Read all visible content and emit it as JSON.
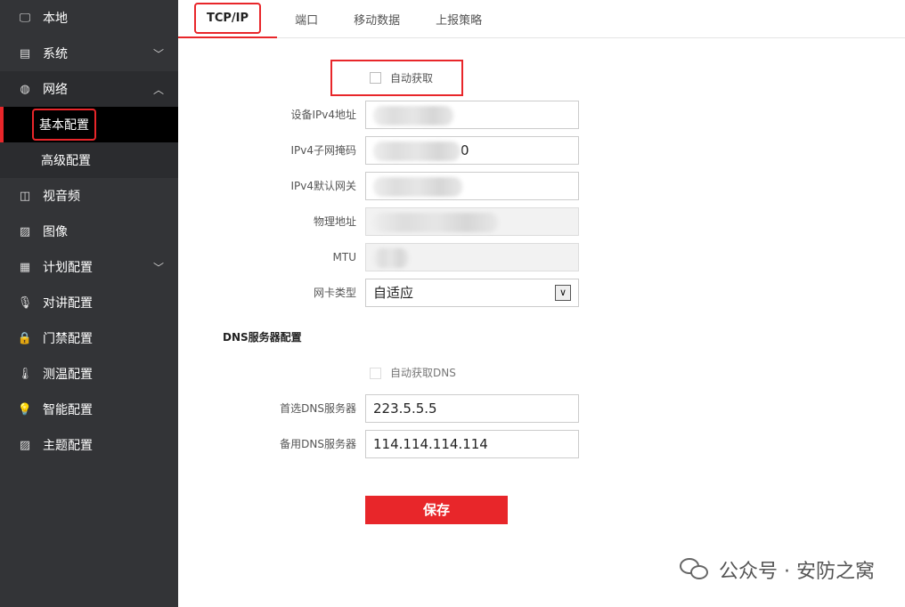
{
  "sidebar": {
    "items": [
      {
        "label": "本地",
        "icon": "monitor-icon"
      },
      {
        "label": "系统",
        "icon": "window-icon"
      },
      {
        "label": "网络",
        "icon": "globe-icon"
      },
      {
        "label": "基本配置"
      },
      {
        "label": "高级配置"
      },
      {
        "label": "视音频",
        "icon": "video-icon"
      },
      {
        "label": "图像",
        "icon": "image-icon"
      },
      {
        "label": "计划配置",
        "icon": "calendar-icon"
      },
      {
        "label": "对讲配置",
        "icon": "microphone-icon"
      },
      {
        "label": "门禁配置",
        "icon": "lock-icon"
      },
      {
        "label": "测温配置",
        "icon": "thermometer-icon"
      },
      {
        "label": "智能配置",
        "icon": "lightbulb-icon"
      },
      {
        "label": "主题配置",
        "icon": "theme-image-icon"
      }
    ]
  },
  "tabs": [
    "TCP/IP",
    "端口",
    "移动数据",
    "上报策略"
  ],
  "form": {
    "auto_obtain": "自动获取",
    "ipv4_label": "设备IPv4地址",
    "mask_label": "IPv4子网掩码",
    "mask_visible_tail": "0",
    "gateway_label": "IPv4默认网关",
    "mac_label": "物理地址",
    "mtu_label": "MTU",
    "nic_label": "网卡类型",
    "nic_value": "自适应",
    "dns_section": "DNS服务器配置",
    "auto_dns": "自动获取DNS",
    "dns1_label": "首选DNS服务器",
    "dns1_value": "223.5.5.5",
    "dns2_label": "备用DNS服务器",
    "dns2_value": "114.114.114.114",
    "save": "保存"
  },
  "watermark": "公众号 · 安防之窝",
  "colors": {
    "accent": "#e8262a",
    "sidebar": "#333437"
  }
}
